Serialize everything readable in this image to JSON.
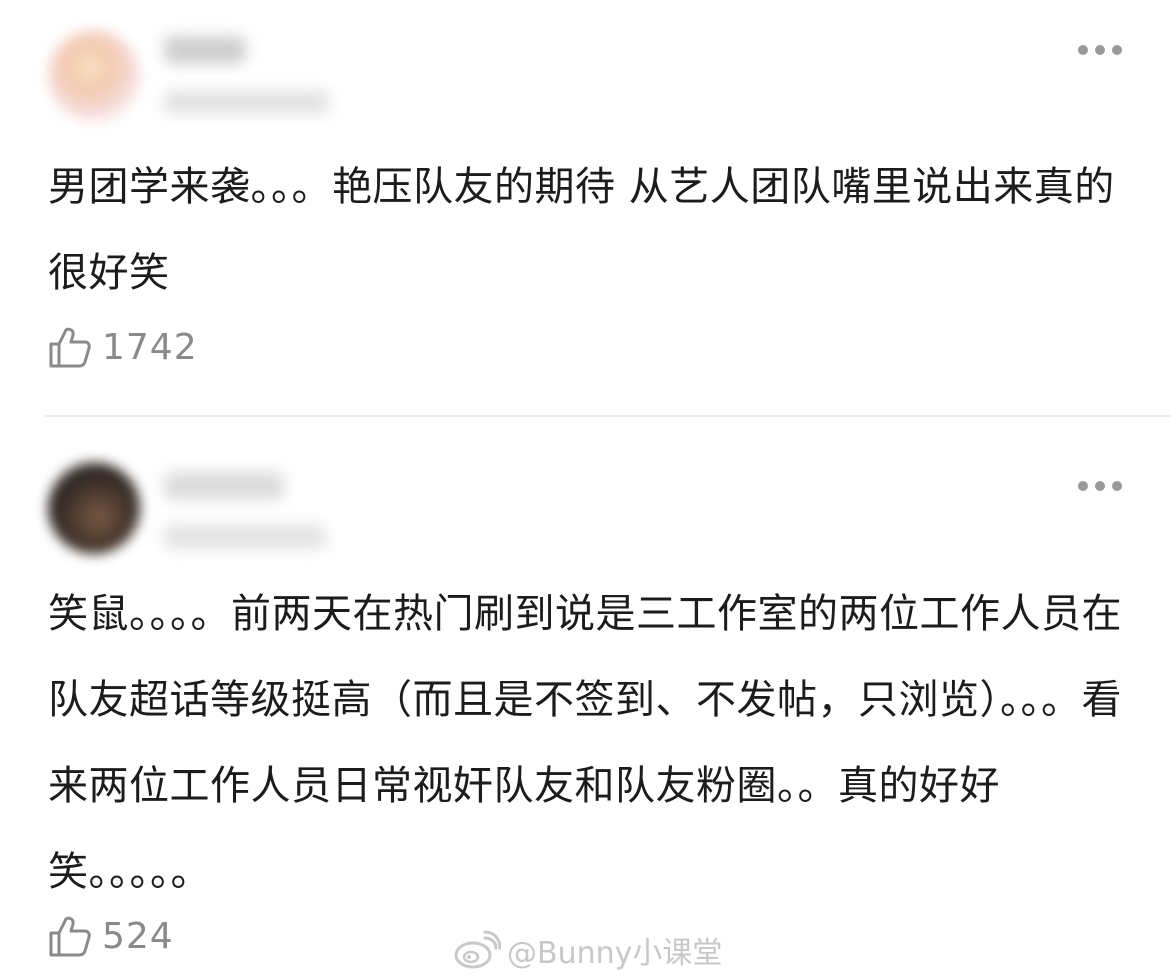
{
  "comments": [
    {
      "text": "男团学来袭。。。艳压队友的期待 从艺人团队嘴里说出来真的很好笑",
      "likes": "1742"
    },
    {
      "text": "笑鼠。。。。前两天在热门刷到说是三工作室的两位工作人员在队友超话等级挺高（而且是不签到、不发帖，只浏览）。。。看来两位工作人员日常视奸队友和队友粉圈。。真的好好笑。。。。。",
      "likes": "524"
    }
  ],
  "watermark": "@Bunny小课堂",
  "icons": {
    "like": "thumbs-up-icon",
    "more": "more-dots-icon",
    "watermark": "weibo-logo-icon"
  },
  "colors": {
    "text": "#1c1c1c",
    "secondary": "#8a8a8a",
    "divider": "#ececec",
    "watermark": "#c8c8c8"
  }
}
